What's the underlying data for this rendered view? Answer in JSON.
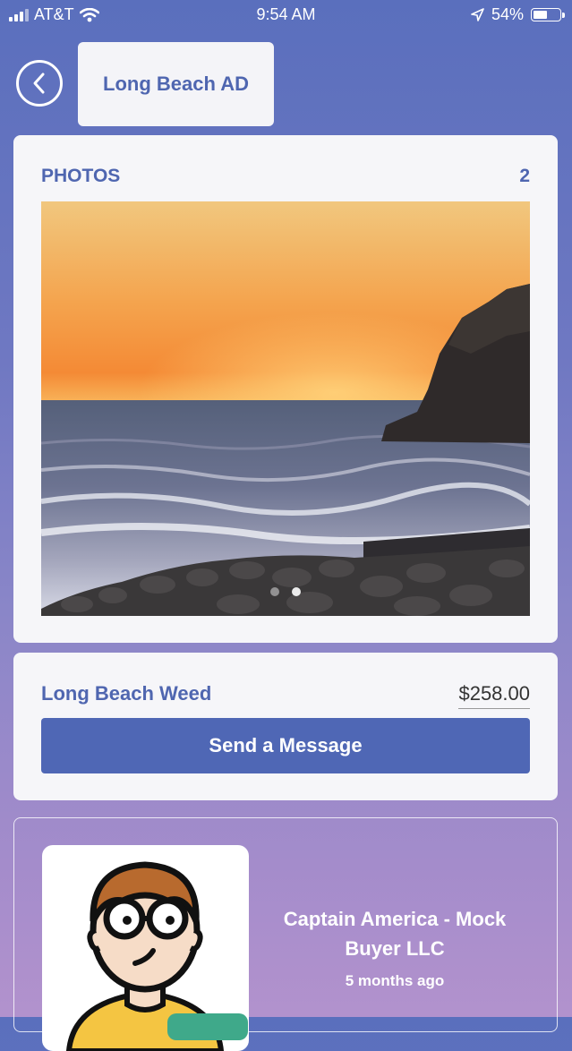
{
  "status": {
    "carrier": "AT&T",
    "time": "9:54 AM",
    "battery": "54%",
    "battery_level": 0.54
  },
  "header": {
    "title": "Long Beach AD",
    "back_icon": "chevron-left-icon"
  },
  "photos": {
    "heading": "PHOTOS",
    "count": "2",
    "active_index": 1,
    "total": 2
  },
  "listing": {
    "name": "Long Beach Weed",
    "price": "$258.00",
    "message_label": "Send a Message"
  },
  "seller": {
    "name": "Captain America - Mock Buyer LLC",
    "time_ago": "5 months ago"
  },
  "colors": {
    "accent": "#4f67b5"
  }
}
